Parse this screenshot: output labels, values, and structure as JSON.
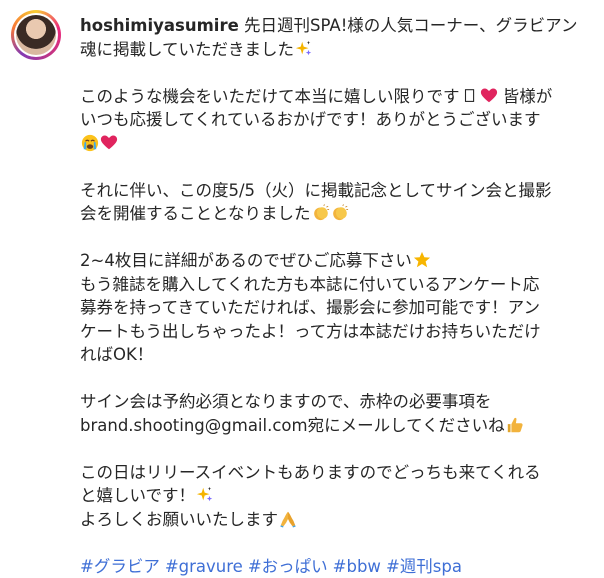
{
  "post": {
    "username": "hoshimiyasumire",
    "paragraphs": [
      {
        "lines": [
          {
            "text": " 先日週刊SPA!様の人気コーナー、グラビアン",
            "emoji": []
          },
          {
            "text": "魂に掲載していただきました",
            "emoji": [
              "sparkles-icon"
            ]
          }
        ]
      },
      {
        "lines": [
          {
            "text": "このような機会をいただけて本当に嬉しい限りです",
            "emoji": [
              "box-glyph",
              "red-heart-icon"
            ],
            "after": "皆様が"
          },
          {
            "text": "いつも応援してくれているおかげです！ありがとうございます",
            "emoji": []
          },
          {
            "text": "",
            "emoji": [
              "crying-face-icon",
              "red-heart-icon"
            ]
          }
        ]
      },
      {
        "lines": [
          {
            "text": "それに伴い、この度5/5（火）に掲載記念としてサイン会と撮影",
            "emoji": []
          },
          {
            "text": "会を開催することとなりました",
            "emoji": [
              "clapping-hands-icon",
              "clapping-hands-icon"
            ]
          }
        ]
      },
      {
        "lines": [
          {
            "text": "2~4枚目に詳細があるのでぜひご応募下さい",
            "emoji": [
              "star-icon"
            ]
          },
          {
            "text": "もう雑誌を購入してくれた方も本誌に付いているアンケート応",
            "emoji": []
          },
          {
            "text": "募券を持ってきていただければ、撮影会に参加可能です！アン",
            "emoji": []
          },
          {
            "text": "ケートもう出しちゃったよ！って方は本誌だけお持ちいただけ",
            "emoji": []
          },
          {
            "text": "ればOK！",
            "emoji": []
          }
        ]
      },
      {
        "lines": [
          {
            "text": "サイン会は予約必須となりますので、赤枠の必要事項を",
            "emoji": []
          },
          {
            "text": "brand.shooting@gmail.com宛にメールしてくださいね",
            "emoji": [
              "thumbs-up-icon"
            ]
          }
        ]
      },
      {
        "lines": [
          {
            "text": "この日はリリースイベントもありますのでどっちも来てくれる",
            "emoji": []
          },
          {
            "text": "と嬉しいです！",
            "emoji": [
              "sparkles-icon"
            ]
          },
          {
            "text": "よろしくお願いいたします",
            "emoji": [
              "folded-hands-icon"
            ]
          }
        ]
      }
    ],
    "hashtags": [
      "#グラビア",
      "#gravure",
      "#おっぱい",
      "#bbw",
      "#週刊spa"
    ],
    "colors": {
      "text": "#262626",
      "hashtag": "#3f6fd6",
      "heart": "#e0245e",
      "sparkle": "#f5b400",
      "clap": "#f2b33d",
      "star": "#f7b500",
      "thumbs": "#f2b33d"
    }
  }
}
